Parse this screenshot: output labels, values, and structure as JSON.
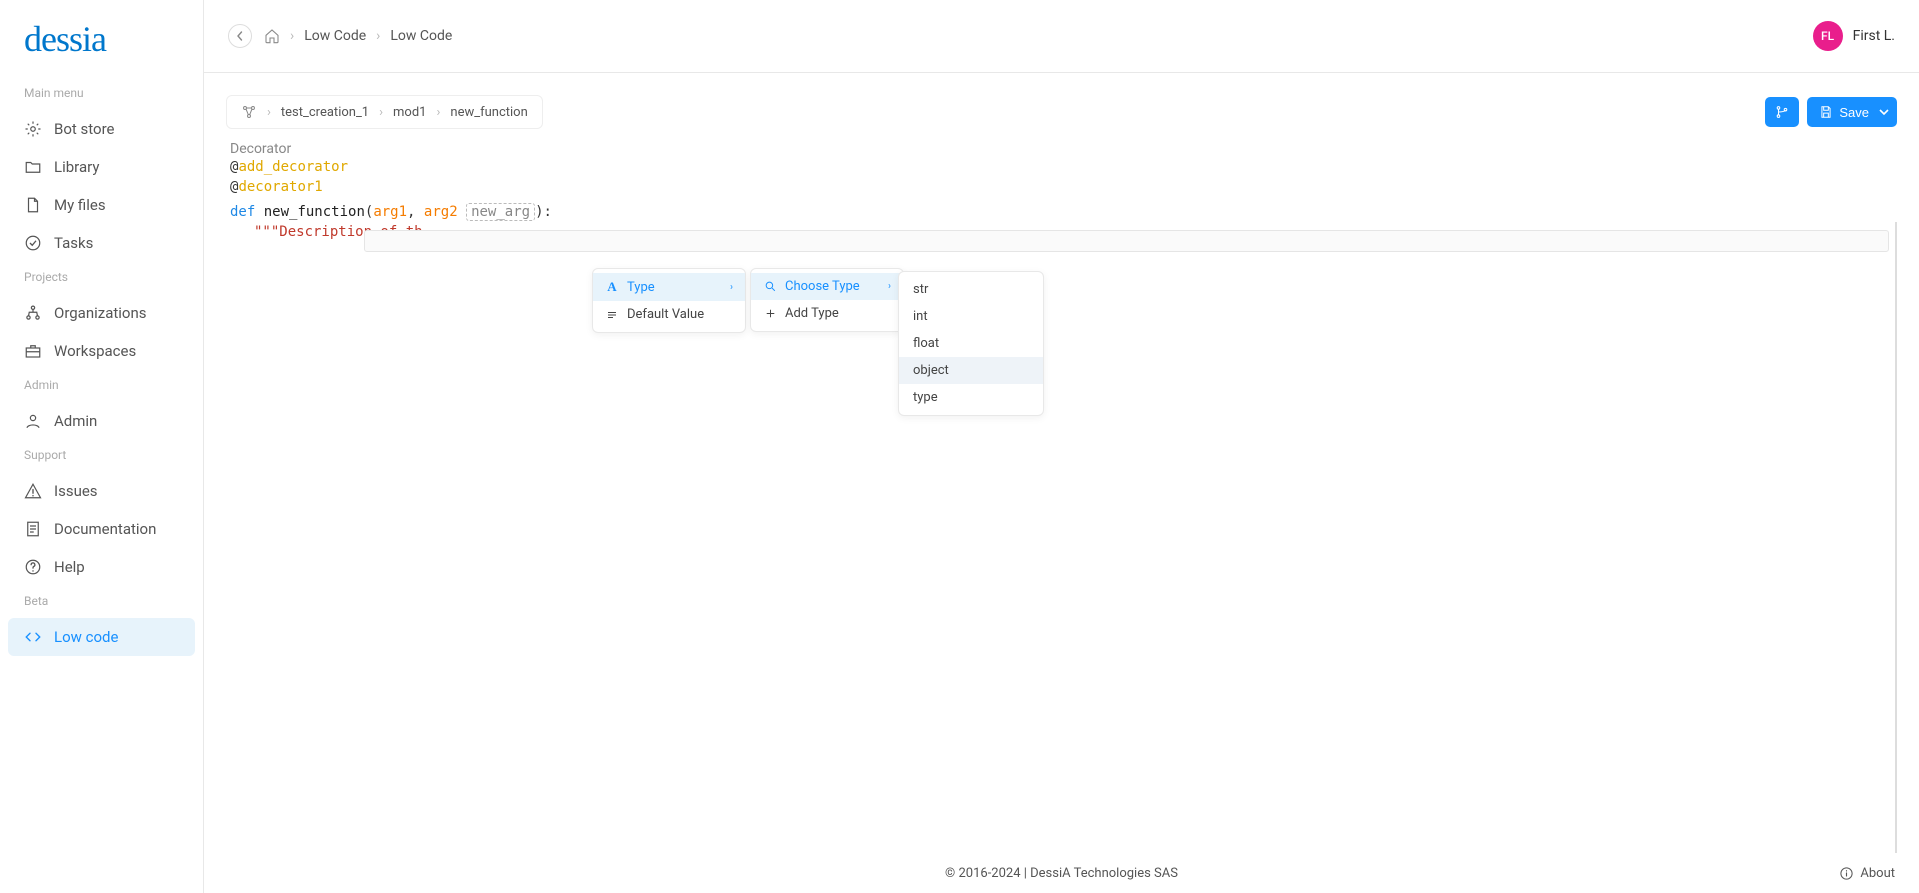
{
  "brand": "dessia",
  "top_breadcrumb": {
    "items": [
      "Low Code",
      "Low Code"
    ]
  },
  "user": {
    "initials": "FL",
    "name": "First L."
  },
  "sidebar": {
    "sections": [
      {
        "heading": "Main menu",
        "items": [
          {
            "label": "Bot store",
            "icon": "bot"
          },
          {
            "label": "Library",
            "icon": "folder"
          },
          {
            "label": "My files",
            "icon": "file"
          },
          {
            "label": "Tasks",
            "icon": "check"
          }
        ]
      },
      {
        "heading": "Projects",
        "items": [
          {
            "label": "Organizations",
            "icon": "org"
          },
          {
            "label": "Workspaces",
            "icon": "briefcase"
          }
        ]
      },
      {
        "heading": "Admin",
        "items": [
          {
            "label": "Admin",
            "icon": "user"
          }
        ]
      },
      {
        "heading": "Support",
        "items": [
          {
            "label": "Issues",
            "icon": "warn"
          },
          {
            "label": "Documentation",
            "icon": "doc"
          },
          {
            "label": "Help",
            "icon": "help"
          }
        ]
      },
      {
        "heading": "Beta",
        "items": [
          {
            "label": "Low code",
            "icon": "code",
            "active": true
          }
        ]
      }
    ]
  },
  "editor": {
    "crumbs": [
      "test_creation_1",
      "mod1",
      "new_function"
    ],
    "save_label": "Save",
    "section_label": "Decorator",
    "decorators": [
      "add_decorator",
      "decorator1"
    ],
    "def_keyword": "def",
    "fn_name": "new_function",
    "args": [
      "arg1",
      "arg2"
    ],
    "new_arg_placeholder": "new_arg",
    "docstring_prefix": "\"\"\"Description of th"
  },
  "menus": {
    "m1": [
      {
        "label": "Type",
        "icon": "A",
        "sub": true,
        "hover": true
      },
      {
        "label": "Default Value",
        "icon": "≡"
      }
    ],
    "m2": [
      {
        "label": "Choose Type",
        "icon": "search",
        "sub": true,
        "hover": true
      },
      {
        "label": "Add Type",
        "icon": "plus"
      }
    ],
    "m3": [
      "str",
      "int",
      "float",
      "object",
      "type"
    ],
    "m3_selected": "object"
  },
  "footer": {
    "copyright": "© 2016-2024 | DessiA Technologies SAS",
    "about": "About"
  }
}
